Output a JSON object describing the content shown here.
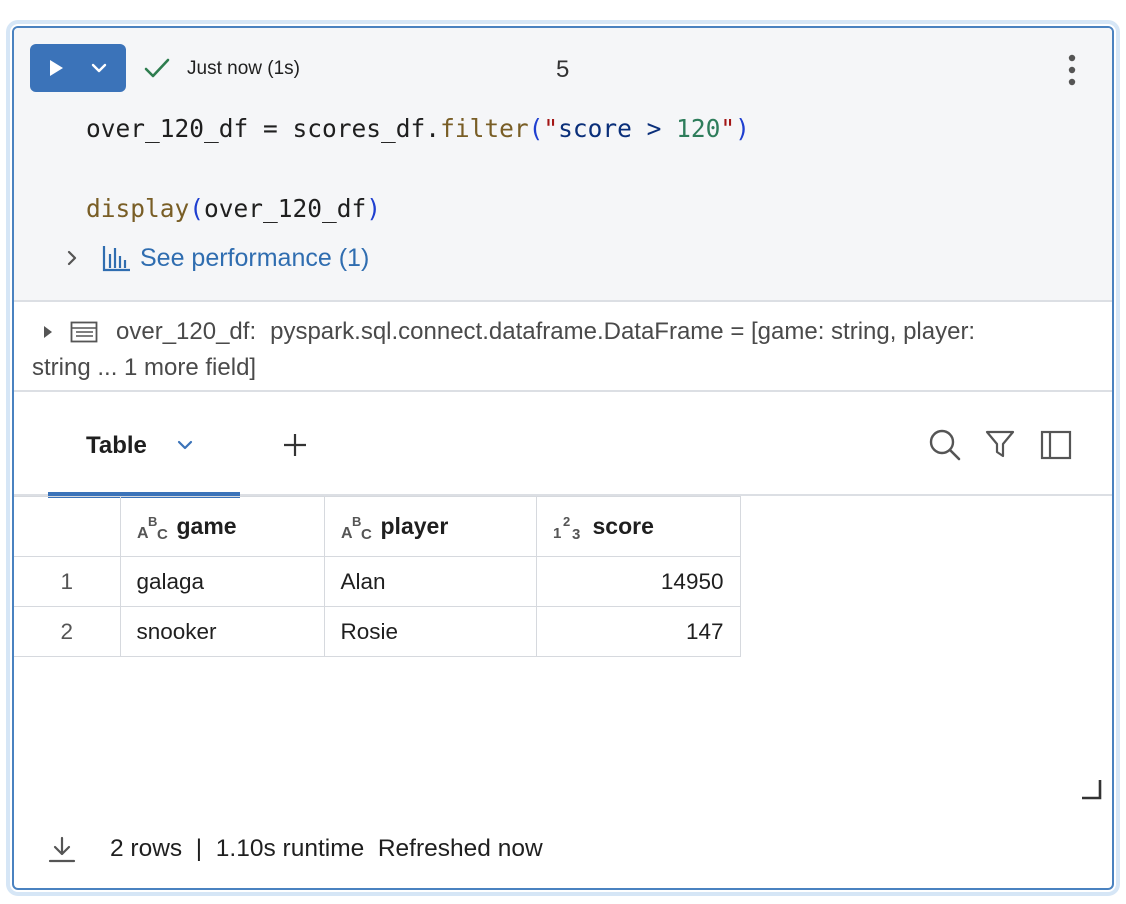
{
  "cell": {
    "status_text": "Just now (1s)",
    "execution_count": "5"
  },
  "code": {
    "line1": {
      "var": "over_120_df",
      "eq": " = ",
      "obj": "scores_df",
      "dot": ".",
      "method": "filter",
      "open": "(",
      "q1": "\"",
      "str": "score > ",
      "num": "120",
      "q2": "\"",
      "close": ")"
    },
    "line2": {
      "fn": "display",
      "open": "(",
      "arg": "over_120_df",
      "close": ")"
    }
  },
  "performance": {
    "label": "See performance (1)"
  },
  "schema": {
    "name": "over_120_df:",
    "type_line1": "pyspark.sql.connect.dataframe.DataFrame = [game: string, player:",
    "type_line2": "string ... 1 more field]"
  },
  "tabs": {
    "table_label": "Table"
  },
  "table": {
    "columns": [
      {
        "name": "game",
        "type_icon": "string-type-icon"
      },
      {
        "name": "player",
        "type_icon": "string-type-icon"
      },
      {
        "name": "score",
        "type_icon": "integer-type-icon"
      }
    ],
    "rows": [
      {
        "index": "1",
        "game": "galaga",
        "player": "Alan",
        "score": "14950"
      },
      {
        "index": "2",
        "game": "snooker",
        "player": "Rosie",
        "score": "147"
      }
    ]
  },
  "footer": {
    "rows": "2 rows",
    "sep": "|",
    "runtime": "1.10s runtime",
    "refreshed": "Refreshed now"
  },
  "colors": {
    "accent": "#3b73b9",
    "link": "#2f6db0",
    "success": "#2e7d4f"
  },
  "icons": [
    "play-icon",
    "chevron-down-icon",
    "check-icon",
    "kebab-menu-icon",
    "chevron-right-icon",
    "bar-chart-icon",
    "table-schema-icon",
    "plus-icon",
    "search-icon",
    "filter-icon",
    "panel-icon",
    "resize-handle-icon",
    "download-icon"
  ]
}
